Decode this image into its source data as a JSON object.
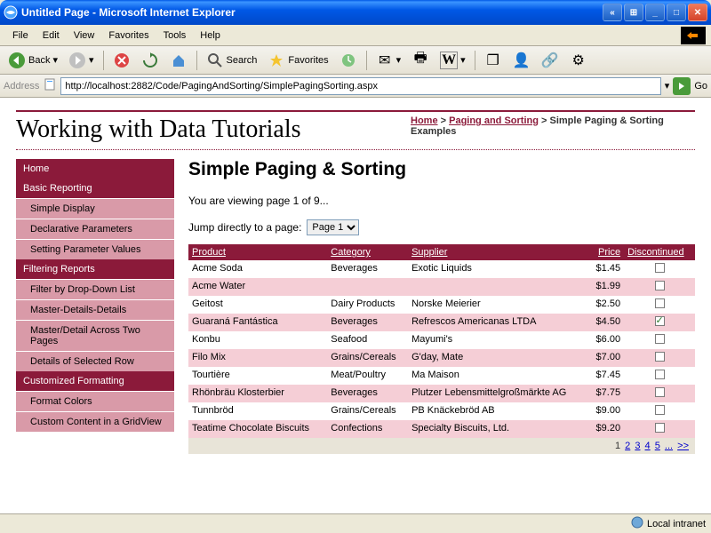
{
  "window": {
    "title": "Untitled Page - Microsoft Internet Explorer"
  },
  "menu": {
    "file": "File",
    "edit": "Edit",
    "view": "View",
    "favorites": "Favorites",
    "tools": "Tools",
    "help": "Help"
  },
  "toolbar": {
    "back": "Back",
    "search": "Search",
    "favorites": "Favorites"
  },
  "address": {
    "label": "Address",
    "url": "http://localhost:2882/Code/PagingAndSorting/SimplePagingSorting.aspx",
    "go": "Go"
  },
  "site": {
    "title": "Working with Data Tutorials",
    "breadcrumb": {
      "home": "Home",
      "section": "Paging and Sorting",
      "current": "Simple Paging & Sorting Examples"
    }
  },
  "nav": [
    {
      "type": "top",
      "label": "Home"
    },
    {
      "type": "top",
      "label": "Basic Reporting"
    },
    {
      "type": "sub",
      "label": "Simple Display"
    },
    {
      "type": "sub",
      "label": "Declarative Parameters"
    },
    {
      "type": "sub",
      "label": "Setting Parameter Values"
    },
    {
      "type": "top",
      "label": "Filtering Reports"
    },
    {
      "type": "sub",
      "label": "Filter by Drop-Down List"
    },
    {
      "type": "sub",
      "label": "Master-Details-Details"
    },
    {
      "type": "sub",
      "label": "Master/Detail Across Two Pages"
    },
    {
      "type": "sub",
      "label": "Details of Selected Row"
    },
    {
      "type": "top",
      "label": "Customized Formatting"
    },
    {
      "type": "sub",
      "label": "Format Colors"
    },
    {
      "type": "sub",
      "label": "Custom Content in a GridView"
    }
  ],
  "page": {
    "heading": "Simple Paging & Sorting",
    "viewing": "You are viewing page 1 of 9...",
    "jump_label": "Jump directly to a page:",
    "jump_selected": "Page 1"
  },
  "grid": {
    "columns": {
      "product": "Product",
      "category": "Category",
      "supplier": "Supplier",
      "price": "Price",
      "discontinued": "Discontinued"
    },
    "rows": [
      {
        "product": "Acme Soda",
        "category": "Beverages",
        "supplier": "Exotic Liquids",
        "price": "$1.45",
        "discontinued": false
      },
      {
        "product": "Acme Water",
        "category": "",
        "supplier": "",
        "price": "$1.99",
        "discontinued": false
      },
      {
        "product": "Geitost",
        "category": "Dairy Products",
        "supplier": "Norske Meierier",
        "price": "$2.50",
        "discontinued": false
      },
      {
        "product": "Guaraná Fantástica",
        "category": "Beverages",
        "supplier": "Refrescos Americanas LTDA",
        "price": "$4.50",
        "discontinued": true
      },
      {
        "product": "Konbu",
        "category": "Seafood",
        "supplier": "Mayumi's",
        "price": "$6.00",
        "discontinued": false
      },
      {
        "product": "Filo Mix",
        "category": "Grains/Cereals",
        "supplier": "G'day, Mate",
        "price": "$7.00",
        "discontinued": false
      },
      {
        "product": "Tourtière",
        "category": "Meat/Poultry",
        "supplier": "Ma Maison",
        "price": "$7.45",
        "discontinued": false
      },
      {
        "product": "Rhönbräu Klosterbier",
        "category": "Beverages",
        "supplier": "Plutzer Lebensmittelgroßmärkte AG",
        "price": "$7.75",
        "discontinued": false
      },
      {
        "product": "Tunnbröd",
        "category": "Grains/Cereals",
        "supplier": "PB Knäckebröd AB",
        "price": "$9.00",
        "discontinued": false
      },
      {
        "product": "Teatime Chocolate Biscuits",
        "category": "Confections",
        "supplier": "Specialty Biscuits, Ltd.",
        "price": "$9.20",
        "discontinued": false
      }
    ],
    "pager": {
      "current": "1",
      "pages": [
        "2",
        "3",
        "4",
        "5"
      ],
      "ellipsis": "...",
      "next": ">>"
    }
  },
  "status": {
    "zone": "Local intranet"
  }
}
